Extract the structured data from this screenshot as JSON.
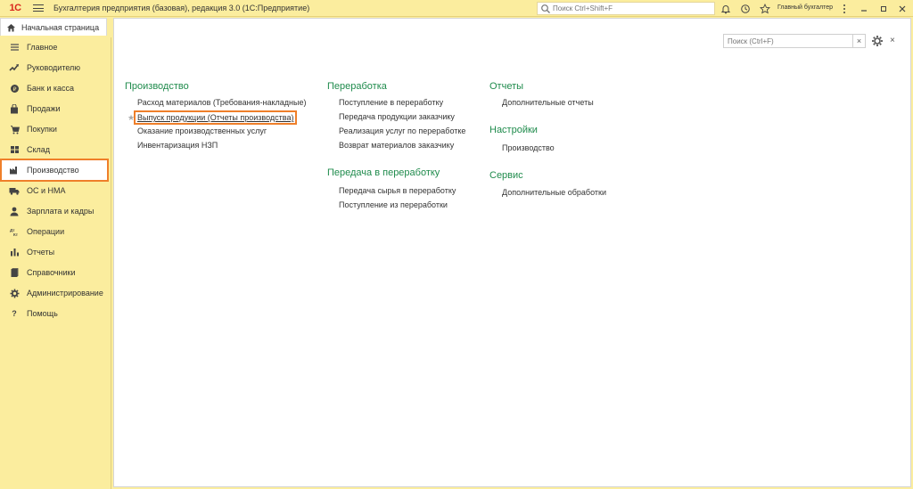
{
  "titlebar": {
    "logo": "1С",
    "title": "Бухгалтерия предприятия (базовая), редакция 3.0  (1С:Предприятие)",
    "search_placeholder": "Поиск Ctrl+Shift+F",
    "user": "Главный бухгалтер"
  },
  "home_tab": {
    "label": "Начальная страница"
  },
  "sidebar": {
    "items": [
      {
        "label": "Главное",
        "icon": "list-icon"
      },
      {
        "label": "Руководителю",
        "icon": "trend-icon"
      },
      {
        "label": "Банк и касса",
        "icon": "coins-icon"
      },
      {
        "label": "Продажи",
        "icon": "bag-icon"
      },
      {
        "label": "Покупки",
        "icon": "cart-icon"
      },
      {
        "label": "Склад",
        "icon": "warehouse-icon"
      },
      {
        "label": "Производство",
        "icon": "factory-icon",
        "active": true
      },
      {
        "label": "ОС и НМА",
        "icon": "truck-icon"
      },
      {
        "label": "Зарплата и кадры",
        "icon": "person-icon"
      },
      {
        "label": "Операции",
        "icon": "operations-icon"
      },
      {
        "label": "Отчеты",
        "icon": "bar-chart-icon"
      },
      {
        "label": "Справочники",
        "icon": "book-icon"
      },
      {
        "label": "Администрирование",
        "icon": "gear-icon"
      },
      {
        "label": "Помощь",
        "icon": "help-icon"
      }
    ]
  },
  "panel": {
    "search_placeholder": "Поиск (Ctrl+F)",
    "clear": "×",
    "close": "×"
  },
  "sections": {
    "production": {
      "title": "Производство",
      "links": [
        "Расход материалов (Требования-накладные)",
        "Выпуск продукции (Отчеты производства)",
        "Оказание производственных услуг",
        "Инвентаризация НЗП"
      ]
    },
    "processing": {
      "title": "Переработка",
      "links": [
        "Поступление в переработку",
        "Передача продукции заказчику",
        "Реализация услуг по переработке",
        "Возврат материалов заказчику"
      ]
    },
    "transfer": {
      "title": "Передача в переработку",
      "links": [
        "Передача сырья в переработку",
        "Поступление из переработки"
      ]
    },
    "reports": {
      "title": "Отчеты",
      "links": [
        "Дополнительные отчеты"
      ]
    },
    "settings": {
      "title": "Настройки",
      "links": [
        "Производство"
      ]
    },
    "service": {
      "title": "Сервис",
      "links": [
        "Дополнительные обработки"
      ]
    }
  },
  "colors": {
    "accent_green": "#1f8b4c",
    "highlight_orange": "#ef7f2a",
    "panel_yellow": "#fbed9e"
  }
}
